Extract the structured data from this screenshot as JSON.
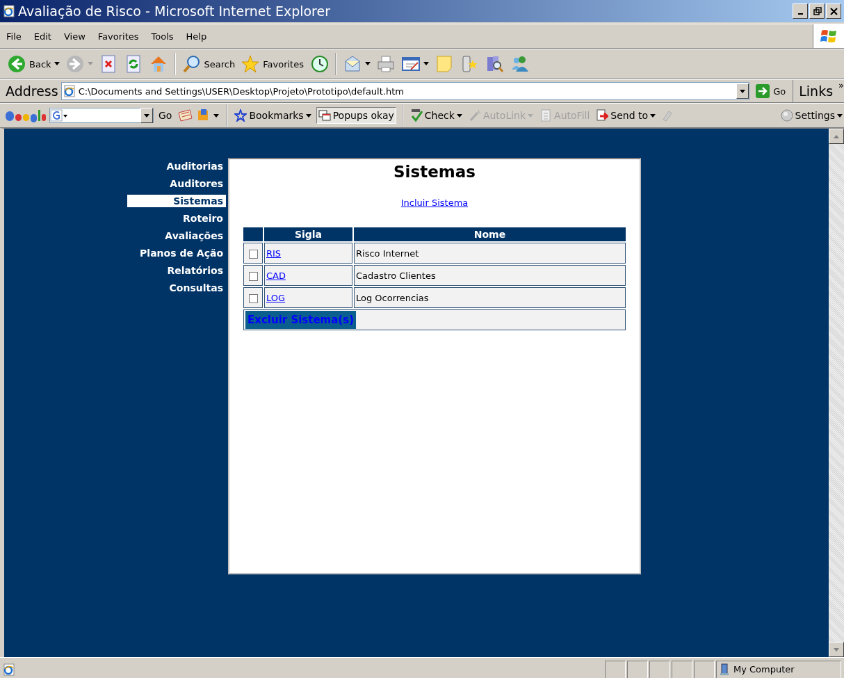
{
  "window": {
    "title": "Avaliação de Risco - Microsoft Internet Explorer"
  },
  "menu": [
    "File",
    "Edit",
    "View",
    "Favorites",
    "Tools",
    "Help"
  ],
  "toolbar": {
    "buttons": [
      {
        "label": "Back"
      },
      {
        "label": "Search"
      },
      {
        "label": "Favorites"
      }
    ]
  },
  "address": {
    "label": "Address",
    "value": "C:\\Documents and Settings\\USER\\Desktop\\Projeto\\Prototipo\\default.htm",
    "go": "Go",
    "links": "Links",
    "more": "»"
  },
  "google_toolbar": {
    "go": "Go",
    "items": [
      {
        "label": "Bookmarks",
        "disabled": false
      },
      {
        "label": "Popups okay",
        "disabled": false
      },
      {
        "label": "Check",
        "disabled": false
      },
      {
        "label": "AutoLink",
        "disabled": true
      },
      {
        "label": "AutoFill",
        "disabled": true
      },
      {
        "label": "Send to",
        "disabled": false
      },
      {
        "label": "Settings",
        "disabled": false
      }
    ]
  },
  "nav": [
    {
      "label": "Auditorias",
      "selected": false
    },
    {
      "label": "Auditores",
      "selected": false
    },
    {
      "label": "Sistemas",
      "selected": true
    },
    {
      "label": "Roteiro",
      "selected": false
    },
    {
      "label": "Avaliações",
      "selected": false
    },
    {
      "label": "Planos de Ação",
      "selected": false
    },
    {
      "label": "Relatórios",
      "selected": false
    },
    {
      "label": "Consultas",
      "selected": false
    }
  ],
  "page": {
    "heading": "Sistemas",
    "add_link": "Incluir Sistema",
    "table": {
      "columns": [
        "Sigla",
        "Nome"
      ],
      "rows": [
        {
          "checked": false,
          "sigla": "RIS",
          "nome": "Risco Internet"
        },
        {
          "checked": false,
          "sigla": "CAD",
          "nome": "Cadastro Clientes"
        },
        {
          "checked": false,
          "sigla": "LOG",
          "nome": "Log Ocorrencias"
        }
      ]
    },
    "delete_button": "Excluir Sistema(s)"
  },
  "status_bar": {
    "zone": "My Computer"
  }
}
